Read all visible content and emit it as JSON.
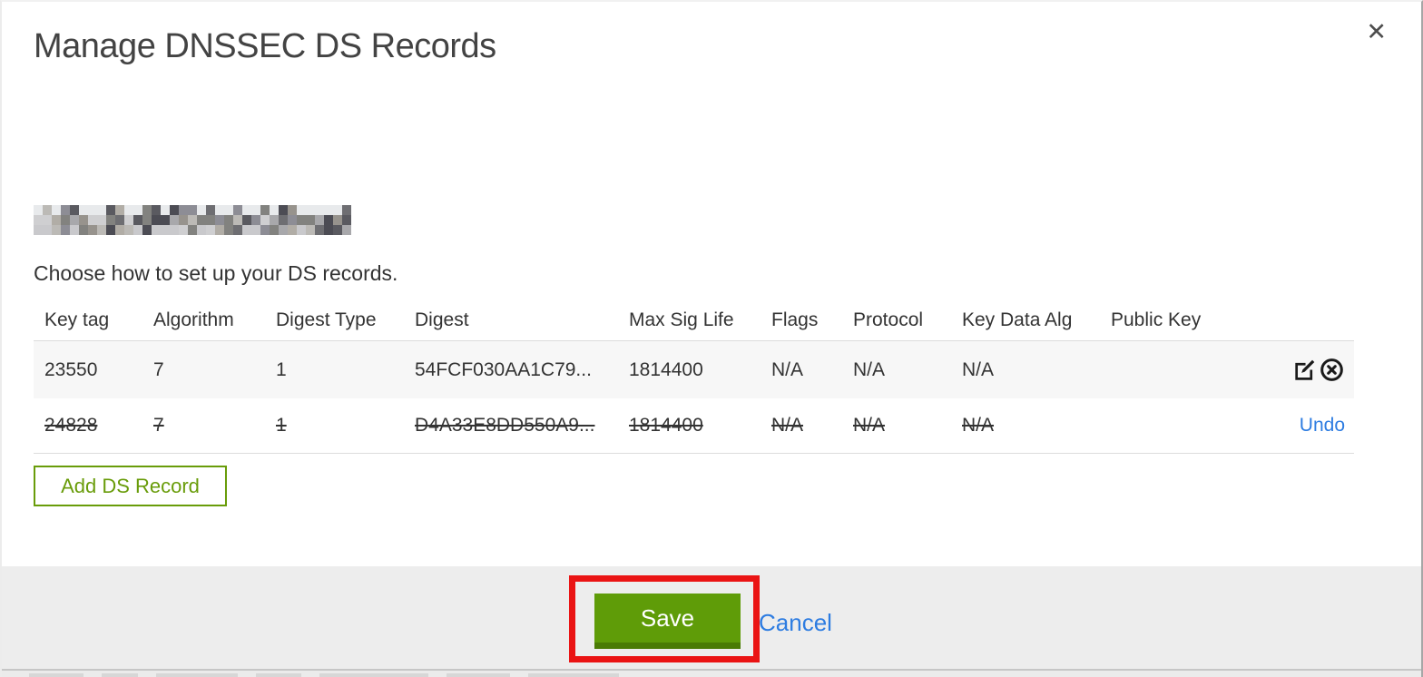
{
  "modal": {
    "title": "Manage DNSSEC DS Records",
    "close_icon": "✕",
    "domain": {
      "redacted": true
    },
    "subtitle": "Choose how to set up your DS records."
  },
  "table": {
    "columns": [
      "Key tag",
      "Algorithm",
      "Digest Type",
      "Digest",
      "Max Sig Life",
      "Flags",
      "Protocol",
      "Key Data Alg",
      "Public Key"
    ],
    "column_keys": [
      "key_tag",
      "algorithm",
      "digest_type",
      "digest",
      "max_sig_life",
      "flags",
      "protocol",
      "key_data_alg",
      "public_key"
    ],
    "rows": [
      {
        "key_tag": "23550",
        "algorithm": "7",
        "digest_type": "1",
        "digest": "54FCF030AA1C79...",
        "max_sig_life": "1814400",
        "flags": "N/A",
        "protocol": "N/A",
        "key_data_alg": "N/A",
        "public_key": "",
        "state": "normal",
        "actions": [
          "edit",
          "delete"
        ]
      },
      {
        "key_tag": "24828",
        "algorithm": "7",
        "digest_type": "1",
        "digest": "D4A33E8DD550A9...",
        "max_sig_life": "1814400",
        "flags": "N/A",
        "protocol": "N/A",
        "key_data_alg": "N/A",
        "public_key": "",
        "state": "deleted",
        "actions": [
          "undo"
        ],
        "undo_label": "Undo"
      }
    ]
  },
  "buttons": {
    "add_ds_record": "Add DS Record",
    "save": "Save",
    "cancel": "Cancel"
  },
  "annotation": {
    "type": "highlight-rectangle",
    "target": "save-button",
    "color": "#ea1414"
  },
  "colors": {
    "outline_green": "#699c0a",
    "save_green": "#5f9c08",
    "save_green_dark": "#4a7b04",
    "link_blue": "#2d7ce1",
    "footer_gray": "#ededed",
    "row_alt_gray": "#f7f7f7"
  }
}
